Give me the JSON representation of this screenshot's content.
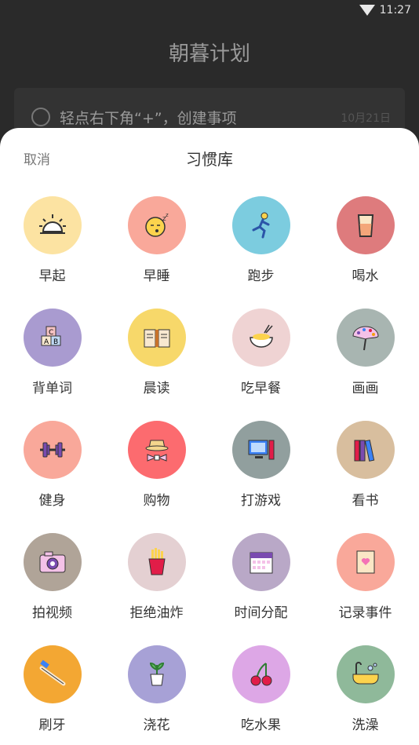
{
  "status_bar": {
    "time": "11:27"
  },
  "background": {
    "title": "朝暮计划",
    "card_text": "轻点右下角“+”，创建事项",
    "card_date": "10月21日"
  },
  "sheet": {
    "cancel_label": "取消",
    "title": "习惯库",
    "habits": [
      {
        "label": "早起",
        "color": "#FCE3A2",
        "icon": "sunrise-icon"
      },
      {
        "label": "早睡",
        "color": "#F9A89A",
        "icon": "sleepy-face-icon"
      },
      {
        "label": "跑步",
        "color": "#7CCCDF",
        "icon": "runner-icon"
      },
      {
        "label": "喝水",
        "color": "#DE7B7D",
        "icon": "water-glass-icon"
      },
      {
        "label": "背单词",
        "color": "#A99BD0",
        "icon": "alphabet-blocks-icon"
      },
      {
        "label": "晨读",
        "color": "#F7D86A",
        "icon": "open-book-icon"
      },
      {
        "label": "吃早餐",
        "color": "#EFD3D3",
        "icon": "rice-bowl-icon"
      },
      {
        "label": "画画",
        "color": "#A8B5B1",
        "icon": "palette-icon"
      },
      {
        "label": "健身",
        "color": "#F9A89A",
        "icon": "dumbbell-icon"
      },
      {
        "label": "购物",
        "color": "#FC6B6F",
        "icon": "hat-bowtie-icon"
      },
      {
        "label": "打游戏",
        "color": "#919F9E",
        "icon": "computer-icon"
      },
      {
        "label": "看书",
        "color": "#D8BE9E",
        "icon": "books-icon"
      },
      {
        "label": "拍视频",
        "color": "#B0A498",
        "icon": "camera-icon"
      },
      {
        "label": "拒绝油炸",
        "color": "#E4D0D2",
        "icon": "french-fries-icon"
      },
      {
        "label": "时间分配",
        "color": "#B9A8C7",
        "icon": "calendar-icon"
      },
      {
        "label": "记录事件",
        "color": "#F9A89A",
        "icon": "card-icon"
      },
      {
        "label": "刷牙",
        "color": "#F3A733",
        "icon": "toothbrush-icon"
      },
      {
        "label": "浇花",
        "color": "#A7A1D6",
        "icon": "potted-plant-icon"
      },
      {
        "label": "吃水果",
        "color": "#DDA7E6",
        "icon": "cherries-icon"
      },
      {
        "label": "洗澡",
        "color": "#8FB99A",
        "icon": "bathtub-icon"
      }
    ]
  }
}
